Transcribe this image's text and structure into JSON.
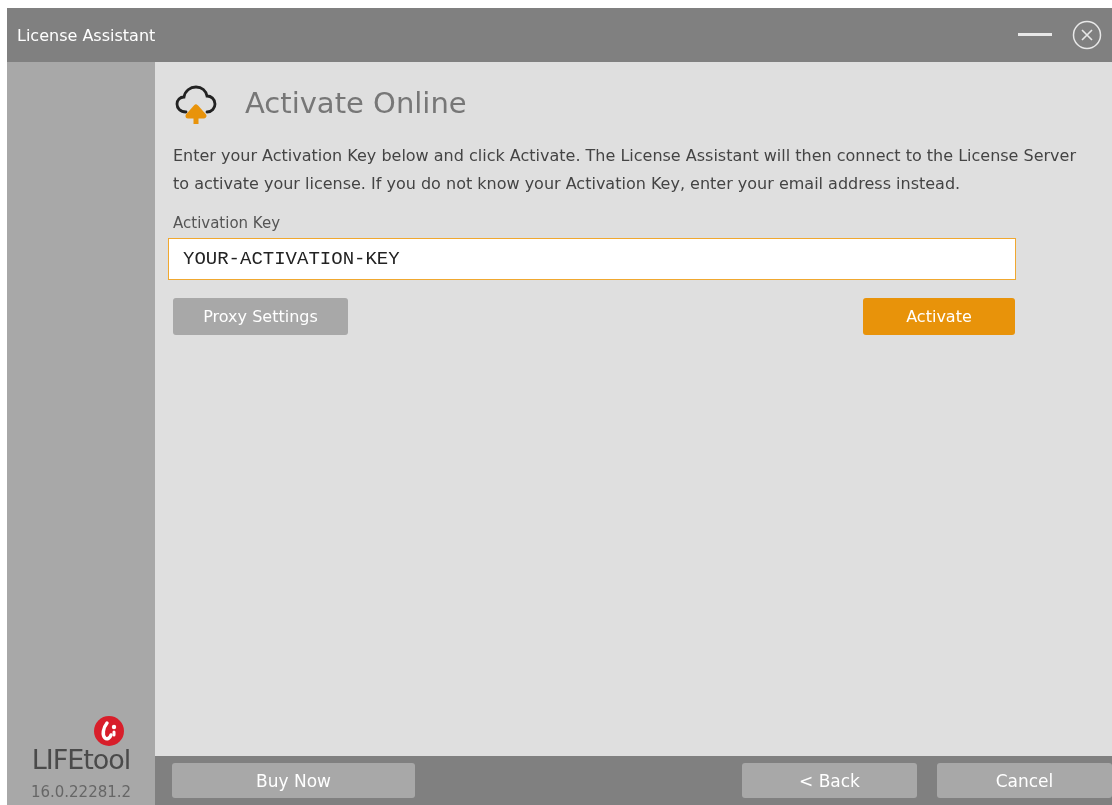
{
  "window": {
    "title": "License Assistant"
  },
  "sidebar": {
    "logo_text": "LIFEtool",
    "version": "16.0.22281.2"
  },
  "page": {
    "heading": "Activate Online",
    "description": "Enter your Activation Key below and click Activate. The License Assistant will then connect to the License Server to activate your license. If you do not know your Activation Key, enter your email address instead.",
    "field": {
      "label": "Activation Key",
      "value": "YOUR-ACTIVATION-KEY",
      "focused": true
    },
    "buttons": [
      {
        "label": "Proxy Settings",
        "kind": "secondary"
      },
      {
        "label": "Activate",
        "kind": "primary"
      }
    ]
  },
  "footer": {
    "buttons": [
      {
        "label": "Buy Now",
        "kind": "left"
      },
      {
        "label": "< Back",
        "kind": "right"
      },
      {
        "label": "Cancel",
        "kind": "right"
      }
    ]
  }
}
